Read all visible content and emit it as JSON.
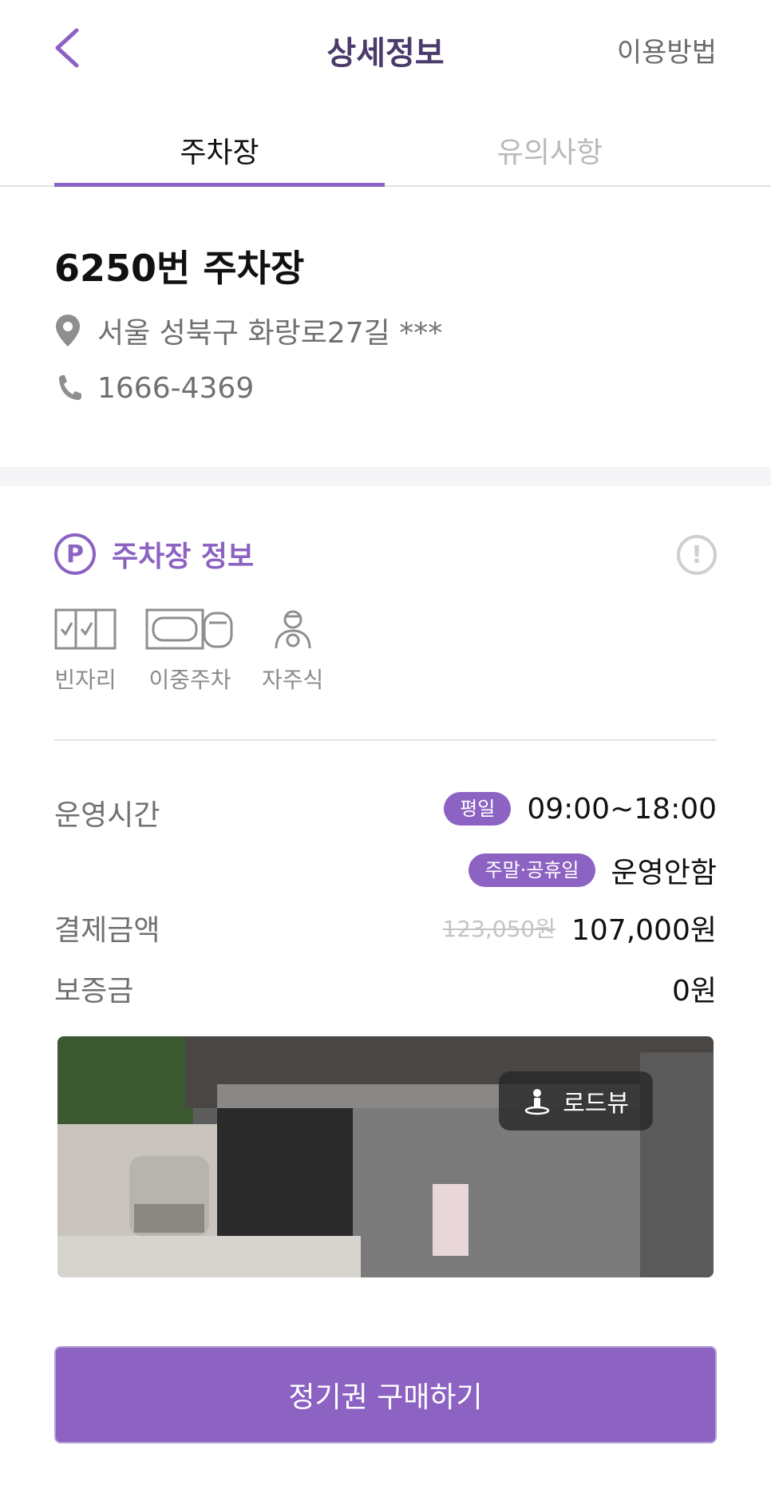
{
  "header": {
    "title": "상세정보",
    "howto_label": "이용방법",
    "back_icon": "chevron-left-icon"
  },
  "tabs": [
    {
      "label": "주차장",
      "active": true
    },
    {
      "label": "유의사항",
      "active": false
    }
  ],
  "lot": {
    "name": "6250번 주차장",
    "address": "서울 성북구 화랑로27길 ***",
    "phone": "1666-4369"
  },
  "section": {
    "badge": "P",
    "title": "주차장 정보",
    "alert_symbol": "!"
  },
  "features": [
    {
      "label": "빈자리",
      "icon": "checkbox-grid-icon"
    },
    {
      "label": "이중주차",
      "icon": "double-parking-icon"
    },
    {
      "label": "자주식",
      "icon": "self-parking-person-icon"
    }
  ],
  "details": {
    "hours_label": "운영시간",
    "weekday_pill": "평일",
    "weekday_hours": "09:00~18:00",
    "weekend_pill": "주말·공휴일",
    "weekend_hours": "운영안함",
    "price_label": "결제금액",
    "original_price": "123,050원",
    "price": "107,000원",
    "deposit_label": "보증금",
    "deposit": "0원"
  },
  "photo": {
    "roadview_label": "로드뷰",
    "roadview_icon": "person-pin-icon"
  },
  "cta": {
    "label": "정기권 구매하기"
  },
  "colors": {
    "accent": "#8c62c2",
    "title": "#4a3b6b"
  }
}
